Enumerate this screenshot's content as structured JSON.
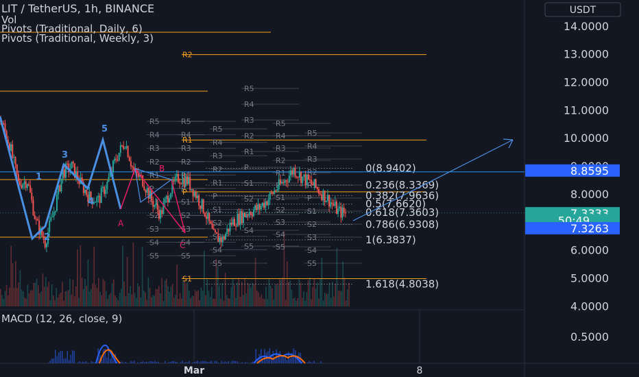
{
  "header": {
    "symbol_line": "LIT / TetherUS, 1h, BINANCE",
    "indicators": [
      "Vol",
      "Pivots (Traditional, Daily, 6)",
      "Pivots (Traditional, Weekly, 3)"
    ],
    "currency_button": "USDT"
  },
  "macd_label": "MACD (12, 26, close, 9)",
  "colors": {
    "background": "#131722",
    "up": "#26a69a",
    "down": "#ef5350",
    "pattern": "#2962ff",
    "pattern_bright": "#4a90e2",
    "fib": "#2196f3",
    "pivot_daily": "#f7a21b",
    "pivot_weekly_labels": "#787b86",
    "abcd": "#e91e63"
  },
  "price_axis": {
    "ticks": [
      "14.0000",
      "13.0000",
      "12.0000",
      "11.0000",
      "10.0000",
      "9.0000",
      "8.0000",
      "7.0000",
      "6.0000",
      "5.0000",
      "4.0000"
    ],
    "tick_values": [
      14,
      13,
      12,
      11,
      10,
      9,
      8,
      7,
      6,
      5,
      4
    ],
    "badges": [
      {
        "text": "8.8595",
        "value": 8.8595,
        "color": "#2962ff"
      },
      {
        "text": "7.3333",
        "value": 7.3333,
        "color": "#26a69a"
      },
      {
        "text": "50:49",
        "value": 7.08,
        "color": "#26a69a"
      },
      {
        "text": "7.3263",
        "value": 6.8,
        "color": "#2962ff"
      }
    ]
  },
  "macd_axis": {
    "ticks": [
      "0.5000"
    ],
    "tick_values": [
      0.5
    ]
  },
  "time_axis": {
    "ticks": [
      "Mar",
      "8"
    ]
  },
  "chart_data": {
    "type": "candlestick",
    "symbol": "LIT / TetherUS",
    "interval": "1h",
    "exchange": "BINANCE",
    "ylim": [
      4.0,
      14.5
    ],
    "last_price": 7.3333,
    "countdown": "50:49",
    "trend_points": [
      {
        "label": "",
        "price": 10.7
      },
      {
        "label": "",
        "price": 9.8
      },
      {
        "label": "",
        "price": 8.4
      },
      {
        "label": "1",
        "price": 8.5
      },
      {
        "label": "",
        "price": 7.0
      },
      {
        "label": "2",
        "price": 6.3
      },
      {
        "label": "",
        "price": 7.4
      },
      {
        "label": "",
        "price": 8.8
      },
      {
        "label": "3",
        "price": 9.0
      },
      {
        "label": "",
        "price": 8.4
      },
      {
        "label": "",
        "price": 7.9
      },
      {
        "label": "4",
        "price": 7.8
      },
      {
        "label": "",
        "price": 8.4
      },
      {
        "label": "",
        "price": 9.3
      },
      {
        "label": "5",
        "price": 9.9
      },
      {
        "label": "",
        "price": 8.8
      },
      {
        "label": "",
        "price": 8.5
      },
      {
        "label": "",
        "price": 7.8
      },
      {
        "label": "A",
        "price": 7.3
      },
      {
        "label": "",
        "price": 8.1
      },
      {
        "label": "",
        "price": 8.6
      },
      {
        "label": "B",
        "price": 8.5
      },
      {
        "label": "",
        "price": 8.0
      },
      {
        "label": "",
        "price": 7.4
      },
      {
        "label": "C",
        "price": 6.5
      },
      {
        "label": "",
        "price": 6.4
      },
      {
        "label": "",
        "price": 7.0
      },
      {
        "label": "",
        "price": 7.2
      },
      {
        "label": "",
        "price": 7.4
      },
      {
        "label": "",
        "price": 7.5
      },
      {
        "label": "",
        "price": 7.8
      },
      {
        "label": "",
        "price": 8.2
      },
      {
        "label": "",
        "price": 8.5
      },
      {
        "label": "",
        "price": 8.9
      },
      {
        "label": "",
        "price": 8.6
      },
      {
        "label": "",
        "price": 8.4
      },
      {
        "label": "",
        "price": 8.1
      },
      {
        "label": "",
        "price": 7.8
      },
      {
        "label": "",
        "price": 7.4
      },
      {
        "label": "",
        "price": 7.3
      }
    ],
    "wave_labels": [
      "1",
      "2",
      "3",
      "4",
      "5"
    ],
    "abcd_labels": [
      "A",
      "B",
      "C"
    ],
    "fib_retracement": [
      {
        "level": "0",
        "price": 8.9402,
        "label": "0(8.9402)"
      },
      {
        "level": "0.236",
        "price": 8.3369,
        "label": "0.236(8.3369)"
      },
      {
        "level": "0.382",
        "price": 7.9636,
        "label": "0.382(7.9636)"
      },
      {
        "level": "0.5",
        "price": 7.662,
        "label": "0.5(7.6620)"
      },
      {
        "level": "0.618",
        "price": 7.3603,
        "label": "0.618(7.3603)"
      },
      {
        "level": "0.786",
        "price": 6.9308,
        "label": "0.786(6.9308)"
      },
      {
        "level": "1",
        "price": 6.3837,
        "label": "1(6.3837)"
      },
      {
        "level": "1.618",
        "price": 4.8038,
        "label": "1.618(4.8038)"
      }
    ],
    "pivots_weekly": [
      {
        "label": "R2",
        "price": 13.0
      },
      {
        "label": "R1",
        "price": 9.95
      },
      {
        "label": "P",
        "price": 8.1
      },
      {
        "label": "S1",
        "price": 5.0
      }
    ],
    "pivots_daily_labels": [
      "R5",
      "R4",
      "R3",
      "R2",
      "R1",
      "P",
      "S1",
      "S2",
      "S3",
      "S4",
      "S5"
    ],
    "projection_target": 9.95,
    "macd": {
      "fast": 12,
      "slow": 26,
      "source": "close",
      "signal": 9
    }
  }
}
